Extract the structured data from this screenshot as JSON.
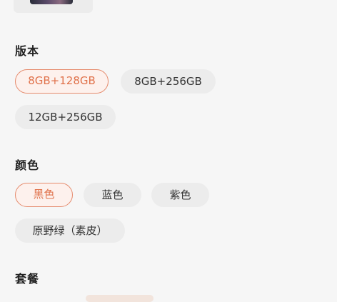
{
  "sections": {
    "version": {
      "title": "版本",
      "options": [
        "8GB+128GB",
        "8GB+256GB",
        "12GB+256GB"
      ],
      "selected": "8GB+128GB"
    },
    "color": {
      "title": "颜色",
      "options": [
        "黑色",
        "蓝色",
        "紫色",
        "原野绿（素皮）"
      ],
      "selected": "黑色"
    },
    "package": {
      "title": "套餐"
    }
  },
  "colors": {
    "accent": "#e0714a",
    "accent_border": "#e58a6c",
    "accent_bg": "#fdf1ed",
    "chip_bg": "#ececec",
    "page_bg": "#f6f6f6"
  }
}
